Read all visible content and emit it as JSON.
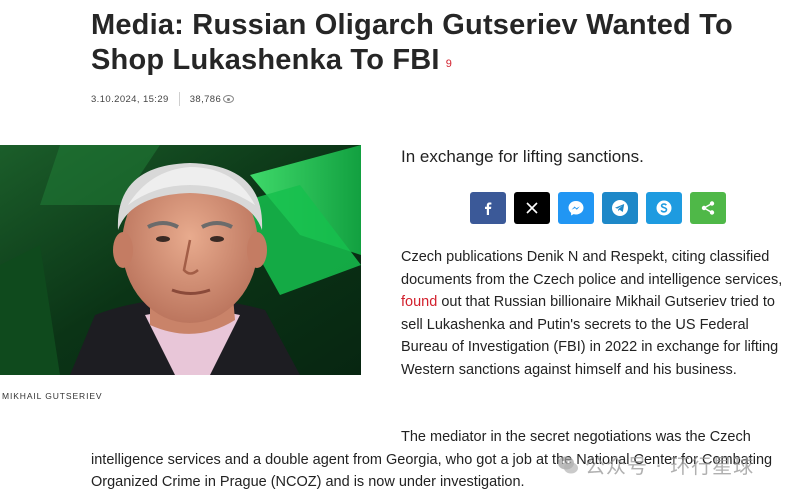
{
  "article": {
    "title": "Media: Russian Oligarch Gutseriev Wanted To Shop Lukashenka To FBI",
    "comment_count": "9",
    "date": "3.10.2024, 15:29",
    "views": "38,786",
    "photo_caption": "MIKHAIL GUTSERIEV",
    "lead": "In exchange for lifting sanctions.",
    "paragraph1": {
      "before_link": "Czech publications Denik N and Respekt, citing classified documents from the Czech police and intelligence services, ",
      "link": "found",
      "after_link": " out that Russian billionaire Mikhail Gutseriev tried to sell Lukashenka and Putin's secrets to the US Federal Bureau of Investigation (FBI) in 2022 in exchange for lifting Western sanctions against himself and his business."
    },
    "paragraph2": {
      "line1": "The mediator in the secret negotiations was the Czech",
      "rest": "intelligence services and a double agent from Georgia, who got a job at the National Center for Combating Organized Crime in Prague (NCOZ) and is now under investigation."
    }
  },
  "share_buttons": [
    {
      "name": "facebook",
      "icon": "facebook-icon",
      "color": "#3b5998"
    },
    {
      "name": "x",
      "icon": "x-icon",
      "color": "#000000"
    },
    {
      "name": "messenger",
      "icon": "messenger-icon",
      "color": "#2196f3"
    },
    {
      "name": "telegram",
      "icon": "telegram-icon",
      "color": "#1e88c8"
    },
    {
      "name": "skype",
      "icon": "skype-icon",
      "color": "#1e9be0"
    },
    {
      "name": "share",
      "icon": "share-icon",
      "color": "#4fb848"
    }
  ],
  "watermark": {
    "text": "公众号 · 环行星球"
  },
  "colors": {
    "accent": "#d21f2c",
    "text": "#222222"
  }
}
